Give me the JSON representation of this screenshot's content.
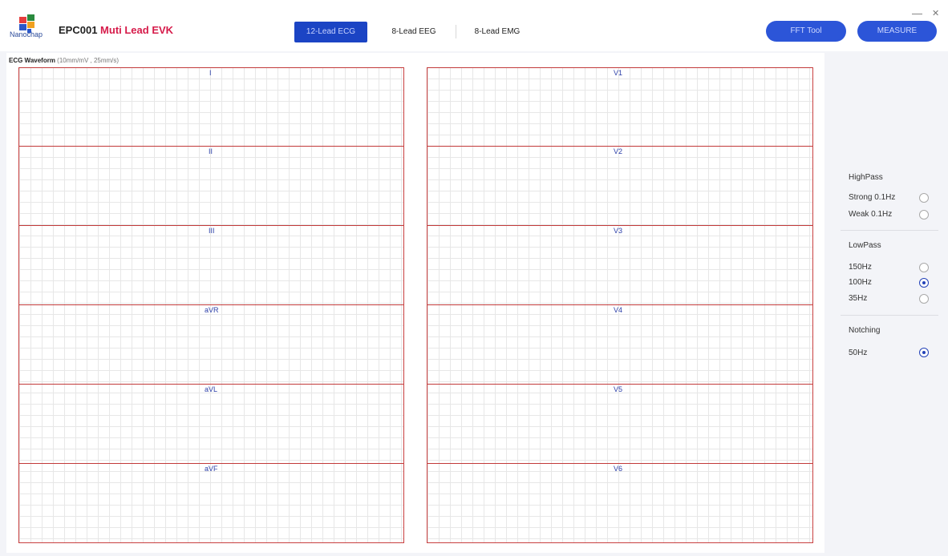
{
  "header": {
    "logo_text": "Nanochap",
    "title_prefix": "EPC001",
    "title_accent": "Muti Lead EVK",
    "tabs": [
      {
        "label": "12-Lead ECG",
        "active": true
      },
      {
        "label": "8-Lead EEG",
        "active": false
      },
      {
        "label": "8-Lead EMG",
        "active": false
      }
    ],
    "fft_button": "FFT Tool",
    "measure_button": "MEASURE",
    "minimize": "—",
    "close": "✕"
  },
  "waveform": {
    "title": "ECG Waveform",
    "subtitle": "(10mm/mV , 25mm/s)",
    "left_leads": [
      "I",
      "II",
      "III",
      "aVR",
      "aVL",
      "aVF"
    ],
    "right_leads": [
      "V1",
      "V2",
      "V3",
      "V4",
      "V5",
      "V6"
    ]
  },
  "filters": {
    "highpass": {
      "title": "HighPass",
      "options": [
        {
          "label": "Strong 0.1Hz",
          "checked": false
        },
        {
          "label": "Weak 0.1Hz",
          "checked": false
        }
      ]
    },
    "lowpass": {
      "title": "LowPass",
      "options": [
        {
          "label": "150Hz",
          "checked": false
        },
        {
          "label": "100Hz",
          "checked": true
        },
        {
          "label": "35Hz",
          "checked": false
        }
      ]
    },
    "notching": {
      "title": "Notching",
      "options": [
        {
          "label": "50Hz",
          "checked": true
        }
      ]
    }
  },
  "colors": {
    "accent": "#d61b4a",
    "primary_button": "#2c55d8",
    "active_tab": "#1b44c4",
    "grid_line": "#c23a3a",
    "lead_label": "#2c3fa8"
  }
}
